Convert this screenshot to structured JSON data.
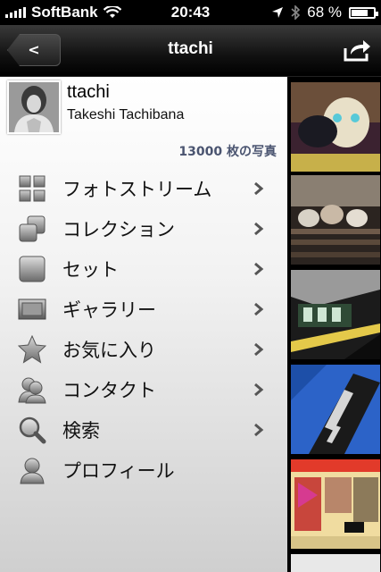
{
  "status_bar": {
    "carrier": "SoftBank",
    "time": "20:43",
    "battery": "68 %",
    "battery_level": 0.68
  },
  "nav": {
    "back_label": "<",
    "title": "ttachi"
  },
  "profile": {
    "username": "ttachi",
    "full_name": "Takeshi Tachibana",
    "photo_count": "13000 枚の写真"
  },
  "menu": [
    {
      "label": "フォトストリーム",
      "icon": "grid-icon",
      "chevron": true
    },
    {
      "label": "コレクション",
      "icon": "stack-icon",
      "chevron": true
    },
    {
      "label": "セット",
      "icon": "square-icon",
      "chevron": true
    },
    {
      "label": "ギャラリー",
      "icon": "frame-icon",
      "chevron": true
    },
    {
      "label": "お気に入り",
      "icon": "star-icon",
      "chevron": true
    },
    {
      "label": "コンタクト",
      "icon": "people-icon",
      "chevron": true
    },
    {
      "label": "検索",
      "icon": "search-icon",
      "chevron": true
    },
    {
      "label": "プロフィール",
      "icon": "person-icon",
      "chevron": false
    }
  ]
}
